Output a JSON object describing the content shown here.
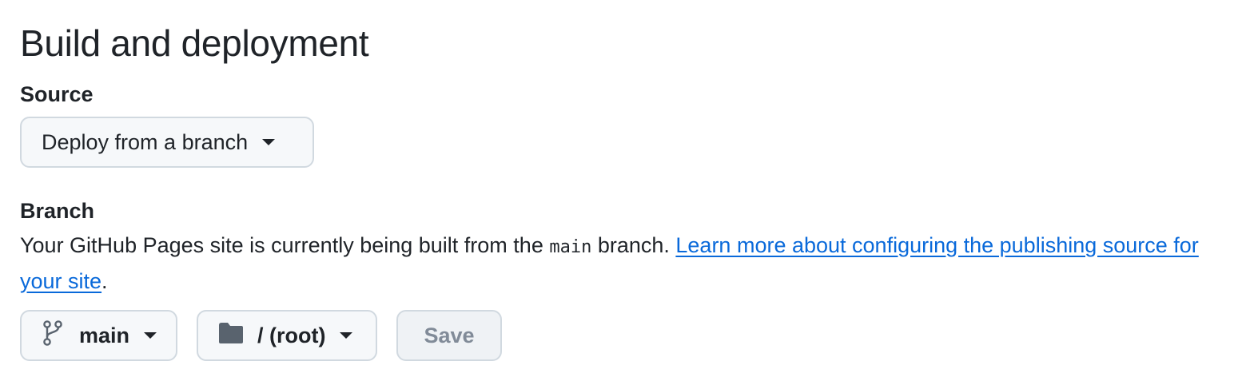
{
  "section": {
    "title": "Build and deployment"
  },
  "source": {
    "label": "Source",
    "selected": "Deploy from a branch"
  },
  "branch": {
    "label": "Branch",
    "description_pre": "Your GitHub Pages site is currently being built from the ",
    "description_code": "main",
    "description_post": " branch. ",
    "learn_more_link": "Learn more about configuring the publishing source for your site",
    "period": ".",
    "branch_selector": "main",
    "folder_selector": "/ (root)",
    "save_label": "Save"
  },
  "icons": {
    "branch": "git-branch-icon",
    "folder": "folder-icon",
    "caret": "triangle-down-icon"
  },
  "colors": {
    "link": "#0969da",
    "text": "#1f2328",
    "disabled_text": "#818b98",
    "button_bg": "#f6f8fa",
    "border": "#d1d9e0"
  }
}
